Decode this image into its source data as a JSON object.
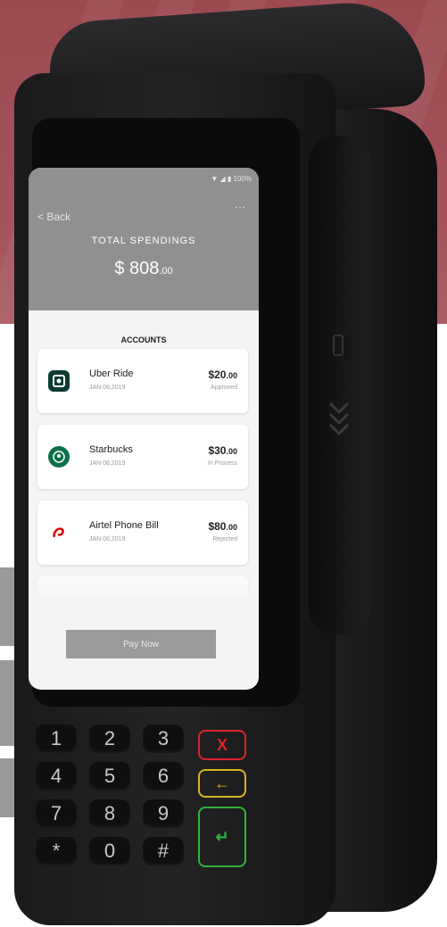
{
  "status_bar": {
    "battery": "100%"
  },
  "header": {
    "back_label": "Back",
    "more_label": "...",
    "total_label": "TOTAL SPENDINGS",
    "total_value_main": "$ 808",
    "total_value_cents": ".00"
  },
  "accounts": {
    "title": "ACCOUNTS",
    "items": [
      {
        "name": "Uber Ride",
        "date": "JAN 08,2019",
        "amount_main": "$20",
        "amount_cents": ".00",
        "status": "Approved",
        "logo": "uber-logo-icon",
        "logo_bg": "#0e3b33"
      },
      {
        "name": "Starbucks",
        "date": "JAN 08,2019",
        "amount_main": "$30",
        "amount_cents": ".00",
        "status": "In Process",
        "logo": "starbucks-logo-icon",
        "logo_bg": "#0b704a"
      },
      {
        "name": "Airtel Phone Bill",
        "date": "JAN 08,2019",
        "amount_main": "$80",
        "amount_cents": ".00",
        "status": "Rejected",
        "logo": "airtel-logo-icon",
        "logo_bg": "#e40000"
      }
    ]
  },
  "pay_button": {
    "label": "Pay Now"
  },
  "keypad": {
    "keys": [
      "1",
      "2",
      "3",
      "4",
      "5",
      "6",
      "7",
      "8",
      "9",
      "*",
      "0",
      "#"
    ],
    "cancel_label": "X",
    "back_label": "←",
    "enter_label": "↵",
    "colors": {
      "cancel": "#d9252b",
      "back": "#d8b323",
      "enter": "#2fb43a"
    }
  },
  "colors": {
    "accent_bg": "#a4525a",
    "header_grey": "#909090"
  }
}
